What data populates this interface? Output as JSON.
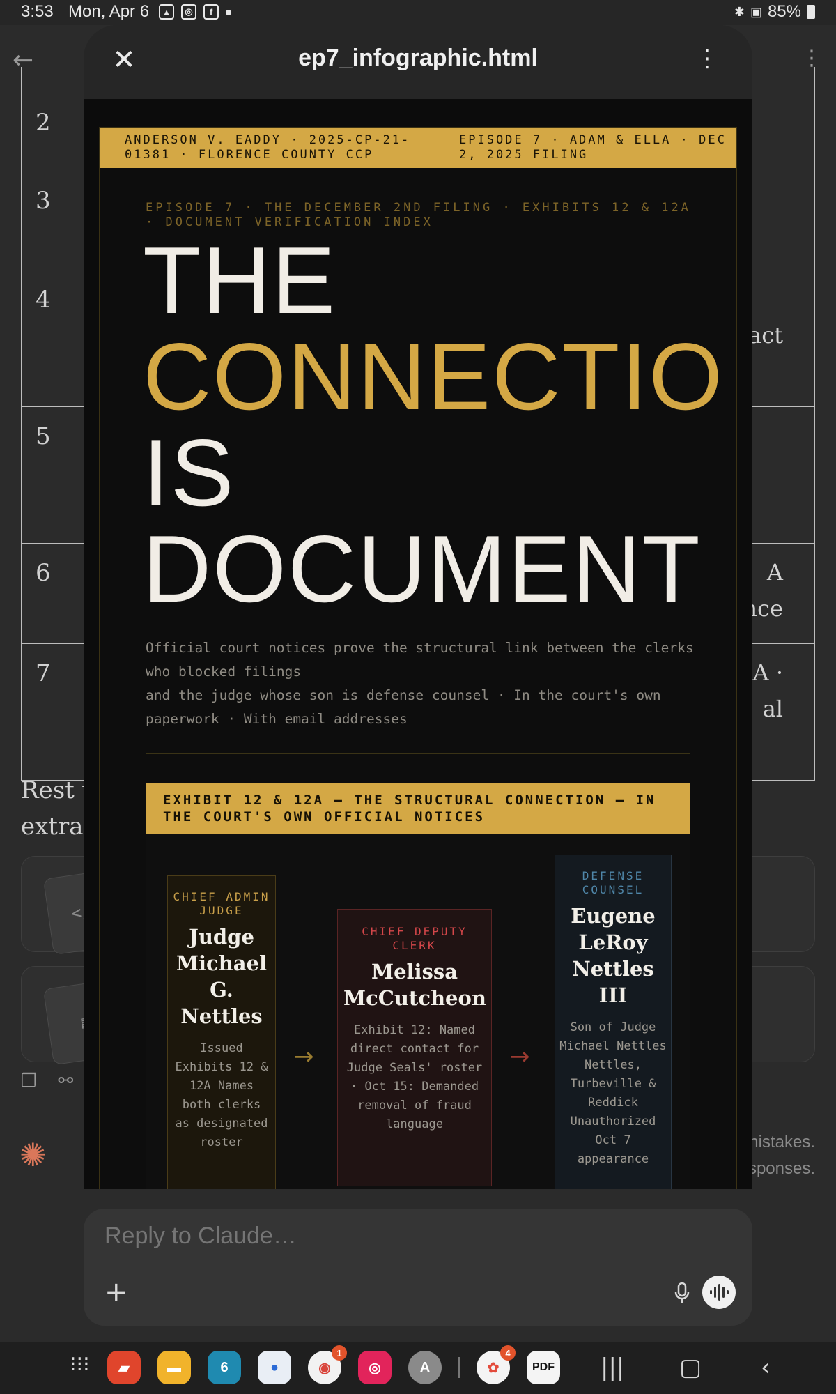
{
  "status_bar": {
    "time": "3:53",
    "date": "Mon, Apr 6",
    "battery": "85%"
  },
  "background": {
    "table_rows": [
      "2",
      "3",
      "4",
      "5",
      "6",
      "7"
    ],
    "row_fragments": [
      "xact",
      "A",
      "nce",
      "A ·",
      "al"
    ],
    "text_fragment_1": "Rest w",
    "text_fragment_2": "extrac",
    "card_code_glyph": "</>",
    "disclaimer_line1": "nistakes.",
    "disclaimer_line2": "sponses."
  },
  "artifact": {
    "title": "ep7_infographic.html",
    "banner_left": "ANDERSON V. EADDY · 2025-CP-21-01381 · FLORENCE COUNTY CCP",
    "banner_right": "EPISODE 7 · ADAM & ELLA · DEC 2, 2025 FILING",
    "kicker": "EPISODE 7 · THE DECEMBER 2ND FILING · EXHIBITS 12 & 12A · DOCUMENT VERIFICATION INDEX",
    "headline": {
      "line1": "THE",
      "line2": "CONNECTIO",
      "line3": "IS",
      "line4": "DOCUMENT"
    },
    "lede_line1": "Official court notices prove the structural link between the clerks who blocked filings",
    "lede_line2": "and the judge whose son is defense counsel · In the court's own paperwork · With email addresses",
    "exhibit_title": "EXHIBIT 12 & 12A — THE STRUCTURAL CONNECTION — IN THE COURT'S OWN OFFICIAL NOTICES",
    "nodes": [
      {
        "role": "CHIEF ADMIN JUDGE",
        "name": "Judge Michael G. Nettles",
        "desc": "Issued Exhibits 12 & 12A Names both clerks as designated roster"
      },
      {
        "role": "CHIEF DEPUTY CLERK",
        "name": "Melissa McCutcheon",
        "desc": "Exhibit 12: Named direct contact for Judge Seals' roster · Oct 15: Demanded removal of fraud language"
      },
      {
        "role": "DEFENSE COUNSEL",
        "name": "Eugene LeRoy Nettles III",
        "desc": "Son of Judge Michael Nettles Nettles, Turbeville & Reddick Unauthorized Oct 7 appearance"
      }
    ],
    "arrow_glyph": "→"
  },
  "composer": {
    "placeholder": "Reply to Claude…"
  },
  "dock": {
    "badges": [
      "1",
      "4"
    ],
    "calendar_day": "6",
    "pdf_label": "PDF",
    "a_label": "A"
  },
  "colors": {
    "gold": "#d4a845",
    "red": "#d4474a",
    "blue": "#4f86a8",
    "page_bg": "#0d0d0d"
  }
}
